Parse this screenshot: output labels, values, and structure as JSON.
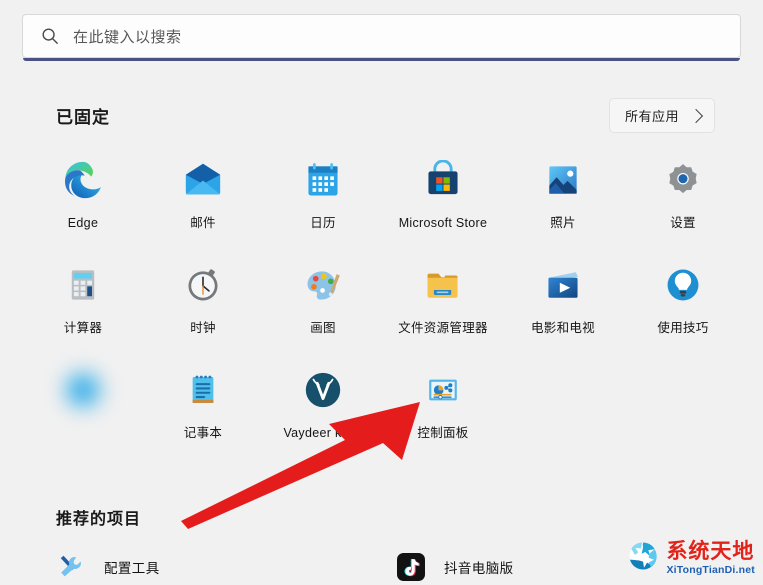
{
  "search": {
    "placeholder": "在此键入以搜索",
    "icon": "search-icon"
  },
  "pinned": {
    "title": "已固定",
    "all_apps_label": "所有应用",
    "all_apps_icon": "chevron-right-icon",
    "apps": [
      {
        "label": "Edge",
        "icon": "edge-icon"
      },
      {
        "label": "邮件",
        "icon": "mail-icon"
      },
      {
        "label": "日历",
        "icon": "calendar-icon"
      },
      {
        "label": "Microsoft Store",
        "icon": "microsoft-store-icon"
      },
      {
        "label": "照片",
        "icon": "photos-icon"
      },
      {
        "label": "设置",
        "icon": "settings-gear-icon"
      },
      {
        "label": "计算器",
        "icon": "calculator-icon"
      },
      {
        "label": "时钟",
        "icon": "clock-icon"
      },
      {
        "label": "画图",
        "icon": "paint-palette-icon"
      },
      {
        "label": "文件资源管理器",
        "icon": "file-explorer-folder-icon"
      },
      {
        "label": "电影和电视",
        "icon": "movies-tv-icon"
      },
      {
        "label": "使用技巧",
        "icon": "tips-lightbulb-icon"
      },
      {
        "label": "",
        "icon": "blurred-app-icon"
      },
      {
        "label": "记事本",
        "icon": "notepad-icon"
      },
      {
        "label": "Vaydeer keyb",
        "icon": "vaydeer-deer-icon"
      },
      {
        "label": "控制面板",
        "icon": "control-panel-icon"
      }
    ]
  },
  "recommended": {
    "title": "推荐的项目",
    "items": [
      {
        "label": "配置工具",
        "icon": "wrench-screwdriver-icon"
      },
      {
        "label": "抖音电脑版",
        "icon": "tiktok-icon"
      }
    ]
  },
  "annotation": {
    "type": "red-arrow",
    "points_to": "控制面板",
    "color": "#e51c1c"
  },
  "watermark": {
    "cn": "系统天地",
    "en": "XiTongTianDi.net",
    "icon": "recycle-circle-logo-icon",
    "cn_color": "#e2231a",
    "en_color": "#1e5fb4"
  },
  "colors": {
    "background": "#f1f1f1",
    "search_accent": "#4a5283",
    "text_primary": "#161616"
  }
}
